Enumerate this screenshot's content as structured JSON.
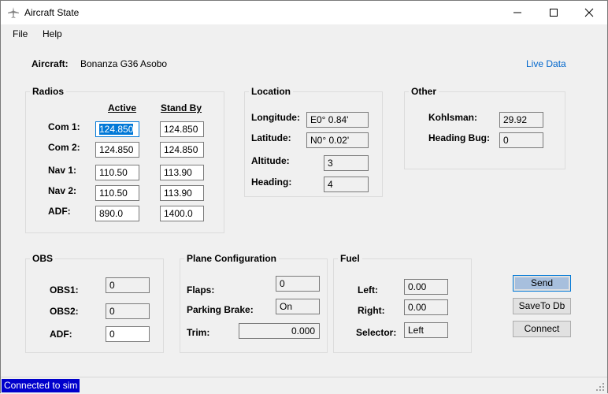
{
  "window": {
    "title": "Aircraft State"
  },
  "menu": {
    "file": "File",
    "help": "Help"
  },
  "aircraft": {
    "label": "Aircraft:",
    "value": "Bonanza G36 Asobo",
    "live_data_link": "Live Data"
  },
  "radios": {
    "title": "Radios",
    "active_header": "Active",
    "standby_header": "Stand By",
    "rows": [
      {
        "label": "Com 1:",
        "active": "124.850",
        "standby": "124.850"
      },
      {
        "label": "Com 2:",
        "active": "124.850",
        "standby": "124.850"
      },
      {
        "label": "Nav 1:",
        "active": "110.50",
        "standby": "113.90"
      },
      {
        "label": "Nav 2:",
        "active": "110.50",
        "standby": "113.90"
      },
      {
        "label": "ADF:",
        "active": "890.0",
        "standby": "1400.0"
      }
    ]
  },
  "location": {
    "title": "Location",
    "longitude_label": "Longitude:",
    "longitude": "E0° 0.84'",
    "latitude_label": "Latitude:",
    "latitude": "N0° 0.02'",
    "altitude_label": "Altitude:",
    "altitude": "3",
    "heading_label": "Heading:",
    "heading": "4"
  },
  "other": {
    "title": "Other",
    "kohlsman_label": "Kohlsman:",
    "kohlsman": "29.92",
    "heading_bug_label": "Heading Bug:",
    "heading_bug": "0"
  },
  "obs": {
    "title": "OBS",
    "obs1_label": "OBS1:",
    "obs1": "0",
    "obs2_label": "OBS2:",
    "obs2": "0",
    "adf_label": "ADF:",
    "adf": "0"
  },
  "plane_config": {
    "title": "Plane Configuration",
    "flaps_label": "Flaps:",
    "flaps": "0",
    "parking_brake_label": "Parking Brake:",
    "parking_brake": "On",
    "trim_label": "Trim:",
    "trim": "0.000"
  },
  "fuel": {
    "title": "Fuel",
    "left_label": "Left:",
    "left": "0.00",
    "right_label": "Right:",
    "right": "0.00",
    "selector_label": "Selector:",
    "selector": "Left"
  },
  "buttons": {
    "send": "Send",
    "save_to_db": "SaveTo Db",
    "connect": "Connect"
  },
  "status": {
    "text": "Connected to sim"
  },
  "colors": {
    "status_bg": "#0000cc",
    "link": "#0066cc",
    "selection": "#0078d7"
  }
}
